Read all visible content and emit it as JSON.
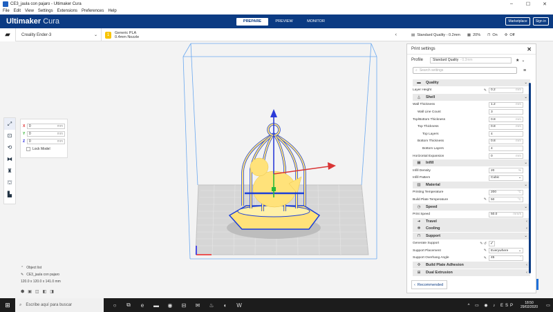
{
  "window": {
    "title": "CE3_jaula con pajaro - Ultimaker Cura",
    "controls": [
      "–",
      "☐",
      "✕"
    ]
  },
  "menu": [
    "File",
    "Edit",
    "View",
    "Settings",
    "Extensions",
    "Preferences",
    "Help"
  ],
  "header": {
    "brand_bold": "Ultimaker",
    "brand_light": " Cura",
    "stages": [
      {
        "label": "PREPARE",
        "active": true
      },
      {
        "label": "PREVIEW",
        "active": false
      },
      {
        "label": "MONITOR",
        "active": false
      }
    ],
    "marketplace": "Marketplace",
    "signin": "Sign in"
  },
  "toolbar": {
    "printer": "Creality Ender-3",
    "material_line1": "Generic PLA",
    "material_line2": "0.4mm Nozzle",
    "quality": "Standard Quality - 0.2mm",
    "infill": "20%",
    "support": "On",
    "adhesion": "Off"
  },
  "transform": {
    "x": {
      "label": "X",
      "value": "0",
      "unit": "mm"
    },
    "y": {
      "label": "Y",
      "value": "0",
      "unit": "mm"
    },
    "z": {
      "label": "Z",
      "value": "0",
      "unit": "mm"
    },
    "lock_label": "Lock Model"
  },
  "object_list": {
    "header": "Object list",
    "name": "CE3_jaula con pajaro",
    "dimensions": "120.0 x 120.0 x 141.0 mm"
  },
  "print_settings": {
    "title": "Print settings",
    "profile_label": "Profile",
    "profile_value": "Standard Quality",
    "profile_sub": "- 0.2mm",
    "search_placeholder": "Search settings",
    "recommended": "Recommended",
    "rows": [
      {
        "kind": "cat",
        "icon": "▬",
        "label": "Quality",
        "chev": "⌄"
      },
      {
        "kind": "set",
        "indent": 0,
        "label": "Layer Height",
        "act": "✎",
        "value": "0.2",
        "unit": "mm"
      },
      {
        "kind": "cat",
        "icon": "⏃",
        "label": "Shell",
        "chev": "⌄"
      },
      {
        "kind": "set",
        "indent": 0,
        "label": "Wall Thickness",
        "act": "",
        "value": "1.2",
        "unit": "mm"
      },
      {
        "kind": "set",
        "indent": 1,
        "label": "Wall Line Count",
        "act": "",
        "value": "3",
        "unit": ""
      },
      {
        "kind": "set",
        "indent": 0,
        "label": "Top/Bottom Thickness",
        "act": "",
        "value": "0.8",
        "unit": "mm"
      },
      {
        "kind": "set",
        "indent": 1,
        "label": "Top Thickness",
        "act": "",
        "value": "0.8",
        "unit": "mm"
      },
      {
        "kind": "set",
        "indent": 2,
        "label": "Top Layers",
        "act": "",
        "value": "4",
        "unit": ""
      },
      {
        "kind": "set",
        "indent": 1,
        "label": "Bottom Thickness",
        "act": "",
        "value": "0.8",
        "unit": "mm"
      },
      {
        "kind": "set",
        "indent": 2,
        "label": "Bottom Layers",
        "act": "",
        "value": "4",
        "unit": ""
      },
      {
        "kind": "set",
        "indent": 0,
        "label": "Horizontal Expansion",
        "act": "",
        "value": "0",
        "unit": "mm"
      },
      {
        "kind": "cat",
        "icon": "▦",
        "label": "Infill",
        "chev": "⌄"
      },
      {
        "kind": "set",
        "indent": 0,
        "label": "Infill Density",
        "act": "",
        "value": "20",
        "unit": "%"
      },
      {
        "kind": "set",
        "indent": 0,
        "label": "Infill Pattern",
        "act": "",
        "value": "Cubic",
        "unit": "⌄",
        "select": true
      },
      {
        "kind": "cat",
        "icon": "▥",
        "label": "Material",
        "chev": "⌄"
      },
      {
        "kind": "set",
        "indent": 0,
        "label": "Printing Temperature",
        "act": "",
        "value": "200",
        "unit": "°C"
      },
      {
        "kind": "set",
        "indent": 0,
        "label": "Build Plate Temperature",
        "act": "✎",
        "value": "50",
        "unit": "°C"
      },
      {
        "kind": "cat",
        "icon": "◷",
        "label": "Speed",
        "chev": "⌄"
      },
      {
        "kind": "set",
        "indent": 0,
        "label": "Print Speed",
        "act": "",
        "value": "50.0",
        "unit": "mm/s"
      },
      {
        "kind": "cat",
        "icon": "➜",
        "label": "Travel",
        "chev": "‹"
      },
      {
        "kind": "cat",
        "icon": "✻",
        "label": "Cooling",
        "chev": "‹"
      },
      {
        "kind": "cat",
        "icon": "⊓",
        "label": "Support",
        "chev": "⌄"
      },
      {
        "kind": "set",
        "indent": 0,
        "label": "Generate Support",
        "act": "✎ ↺",
        "value": "✓",
        "unit": "",
        "check": true
      },
      {
        "kind": "set",
        "indent": 0,
        "label": "Support Placement",
        "act": "✎",
        "value": "Everywhere",
        "unit": "⌄",
        "select": true
      },
      {
        "kind": "set",
        "indent": 0,
        "label": "Support Overhang Angle",
        "act": "✎",
        "value": "45",
        "unit": "°"
      },
      {
        "kind": "cat",
        "icon": "✣",
        "label": "Build Plate Adhesion",
        "chev": "‹"
      },
      {
        "kind": "cat",
        "icon": "⊞",
        "label": "Dual Extrusion",
        "chev": "‹"
      }
    ]
  },
  "taskbar": {
    "search_placeholder": "Escribe aquí para buscar",
    "time": "18:50",
    "date": "29/02/2020",
    "tray_icons": "^ ▭ ◉ ♪ ESP"
  },
  "colors": {
    "header_blue": "#0b3b83",
    "model_yellow": "#ffe27a",
    "model_outline": "#1b3fd8",
    "bbox_blue": "#6aa8f0"
  }
}
